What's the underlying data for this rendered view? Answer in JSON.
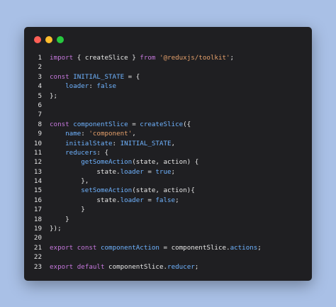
{
  "window": {
    "controls": {
      "close_color": "#ff5f56",
      "minimize_color": "#ffbd2e",
      "maximize_color": "#27c93f"
    },
    "colors": {
      "background": "#1f1f22",
      "page": "#a9c0e6",
      "keyword": "#c678dd",
      "string": "#e5a06b",
      "identifier": "#6fb3ff"
    }
  },
  "code": {
    "lines": [
      {
        "n": "1",
        "tokens": [
          {
            "t": "import",
            "c": "kw"
          },
          {
            "t": " { ",
            "c": "var"
          },
          {
            "t": "createSlice",
            "c": "var"
          },
          {
            "t": " } ",
            "c": "var"
          },
          {
            "t": "from",
            "c": "kw"
          },
          {
            "t": " ",
            "c": "var"
          },
          {
            "t": "'@reduxjs/toolkit'",
            "c": "str"
          },
          {
            "t": ";",
            "c": "var"
          }
        ]
      },
      {
        "n": "2",
        "tokens": []
      },
      {
        "n": "3",
        "tokens": [
          {
            "t": "const",
            "c": "kw"
          },
          {
            "t": " ",
            "c": "var"
          },
          {
            "t": "INITIAL_STATE",
            "c": "const"
          },
          {
            "t": " = {",
            "c": "var"
          }
        ]
      },
      {
        "n": "4",
        "tokens": [
          {
            "t": "    ",
            "c": "var"
          },
          {
            "t": "loader",
            "c": "prop"
          },
          {
            "t": ": ",
            "c": "var"
          },
          {
            "t": "false",
            "c": "bool"
          }
        ]
      },
      {
        "n": "5",
        "tokens": [
          {
            "t": "};",
            "c": "var"
          }
        ]
      },
      {
        "n": "6",
        "tokens": []
      },
      {
        "n": "7",
        "tokens": []
      },
      {
        "n": "8",
        "tokens": [
          {
            "t": "const",
            "c": "kw"
          },
          {
            "t": " ",
            "c": "var"
          },
          {
            "t": "componentSlice",
            "c": "const"
          },
          {
            "t": " = ",
            "c": "var"
          },
          {
            "t": "createSlice",
            "c": "fn"
          },
          {
            "t": "({",
            "c": "var"
          }
        ]
      },
      {
        "n": "9",
        "tokens": [
          {
            "t": "    ",
            "c": "var"
          },
          {
            "t": "name",
            "c": "prop"
          },
          {
            "t": ": ",
            "c": "var"
          },
          {
            "t": "'component'",
            "c": "str"
          },
          {
            "t": ",",
            "c": "var"
          }
        ]
      },
      {
        "n": "10",
        "tokens": [
          {
            "t": "    ",
            "c": "var"
          },
          {
            "t": "initialState",
            "c": "prop"
          },
          {
            "t": ": ",
            "c": "var"
          },
          {
            "t": "INITIAL_STATE",
            "c": "const"
          },
          {
            "t": ",",
            "c": "var"
          }
        ]
      },
      {
        "n": "11",
        "tokens": [
          {
            "t": "    ",
            "c": "var"
          },
          {
            "t": "reducers",
            "c": "prop"
          },
          {
            "t": ": {",
            "c": "var"
          }
        ]
      },
      {
        "n": "12",
        "tokens": [
          {
            "t": "        ",
            "c": "var"
          },
          {
            "t": "getSomeAction",
            "c": "fn"
          },
          {
            "t": "(state, ",
            "c": "var"
          },
          {
            "t": "action",
            "c": "var"
          },
          {
            "t": ") {",
            "c": "var"
          }
        ]
      },
      {
        "n": "13",
        "tokens": [
          {
            "t": "            state.",
            "c": "var"
          },
          {
            "t": "loader",
            "c": "prop"
          },
          {
            "t": " = ",
            "c": "var"
          },
          {
            "t": "true",
            "c": "bool"
          },
          {
            "t": ";",
            "c": "var"
          }
        ]
      },
      {
        "n": "14",
        "tokens": [
          {
            "t": "        },",
            "c": "var"
          }
        ]
      },
      {
        "n": "15",
        "tokens": [
          {
            "t": "        ",
            "c": "var"
          },
          {
            "t": "setSomeAction",
            "c": "fn"
          },
          {
            "t": "(state, ",
            "c": "var"
          },
          {
            "t": "action",
            "c": "var"
          },
          {
            "t": "){",
            "c": "var"
          }
        ]
      },
      {
        "n": "16",
        "tokens": [
          {
            "t": "            state.",
            "c": "var"
          },
          {
            "t": "loader",
            "c": "prop"
          },
          {
            "t": " = ",
            "c": "var"
          },
          {
            "t": "false",
            "c": "bool"
          },
          {
            "t": ";",
            "c": "var"
          }
        ]
      },
      {
        "n": "17",
        "tokens": [
          {
            "t": "        }",
            "c": "var"
          }
        ]
      },
      {
        "n": "18",
        "tokens": [
          {
            "t": "    }",
            "c": "var"
          }
        ]
      },
      {
        "n": "19",
        "tokens": [
          {
            "t": "});",
            "c": "var"
          }
        ]
      },
      {
        "n": "20",
        "tokens": []
      },
      {
        "n": "21",
        "tokens": [
          {
            "t": "export",
            "c": "kw"
          },
          {
            "t": " ",
            "c": "var"
          },
          {
            "t": "const",
            "c": "kw"
          },
          {
            "t": " ",
            "c": "var"
          },
          {
            "t": "componentAction",
            "c": "const"
          },
          {
            "t": " = ",
            "c": "var"
          },
          {
            "t": "componentSlice",
            "c": "var"
          },
          {
            "t": ".",
            "c": "var"
          },
          {
            "t": "actions",
            "c": "prop"
          },
          {
            "t": ";",
            "c": "var"
          }
        ]
      },
      {
        "n": "22",
        "tokens": []
      },
      {
        "n": "23",
        "tokens": [
          {
            "t": "export",
            "c": "kw"
          },
          {
            "t": " ",
            "c": "var"
          },
          {
            "t": "default",
            "c": "kw"
          },
          {
            "t": " ",
            "c": "var"
          },
          {
            "t": "componentSlice",
            "c": "var"
          },
          {
            "t": ".",
            "c": "var"
          },
          {
            "t": "reducer",
            "c": "prop"
          },
          {
            "t": ";",
            "c": "var"
          }
        ]
      }
    ]
  }
}
